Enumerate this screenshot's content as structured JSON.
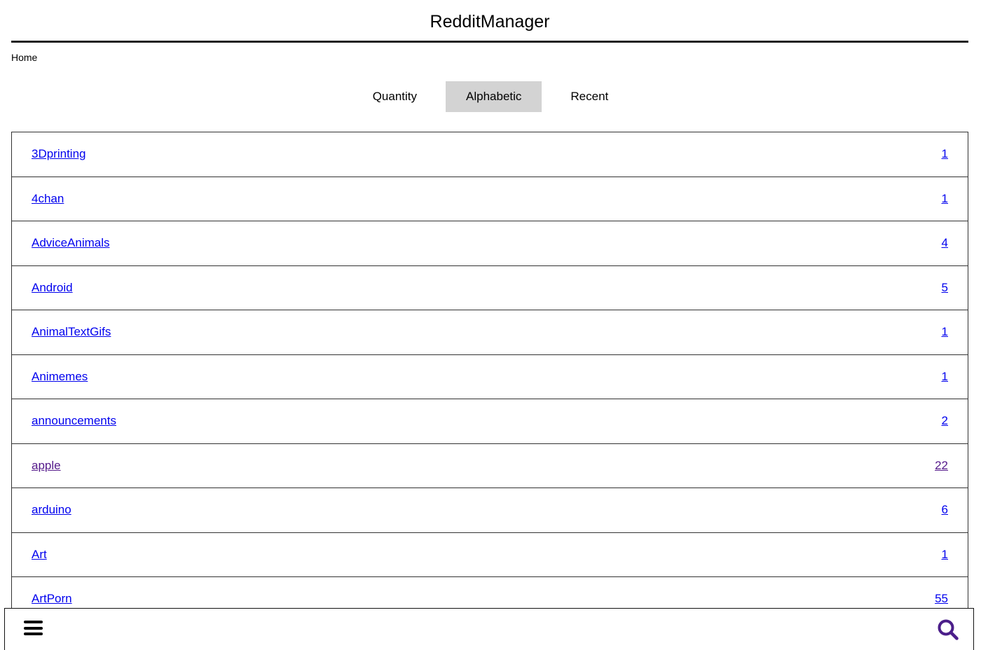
{
  "header": {
    "title": "RedditManager"
  },
  "breadcrumb": {
    "home": "Home"
  },
  "tabs": [
    {
      "label": "Quantity",
      "active": false
    },
    {
      "label": "Alphabetic",
      "active": true
    },
    {
      "label": "Recent",
      "active": false
    }
  ],
  "subreddits": [
    {
      "name": "3Dprinting",
      "count": "1",
      "visited": false
    },
    {
      "name": "4chan",
      "count": "1",
      "visited": false
    },
    {
      "name": "AdviceAnimals",
      "count": "4",
      "visited": false
    },
    {
      "name": "Android",
      "count": "5",
      "visited": false
    },
    {
      "name": "AnimalTextGifs",
      "count": "1",
      "visited": false
    },
    {
      "name": "Animemes",
      "count": "1",
      "visited": false
    },
    {
      "name": "announcements",
      "count": "2",
      "visited": false
    },
    {
      "name": "apple",
      "count": "22",
      "visited": true
    },
    {
      "name": "arduino",
      "count": "6",
      "visited": false
    },
    {
      "name": "Art",
      "count": "1",
      "visited": false
    },
    {
      "name": "ArtPorn",
      "count": "55",
      "visited": false
    }
  ],
  "bottom_bar": {
    "menu_icon": "hamburger-menu-icon",
    "search_icon": "search-icon",
    "search_icon_color": "#4b1e8a"
  },
  "colors": {
    "link": "#0000ee",
    "visited_link": "#551a8b",
    "active_tab_bg": "#d3d3d3"
  }
}
